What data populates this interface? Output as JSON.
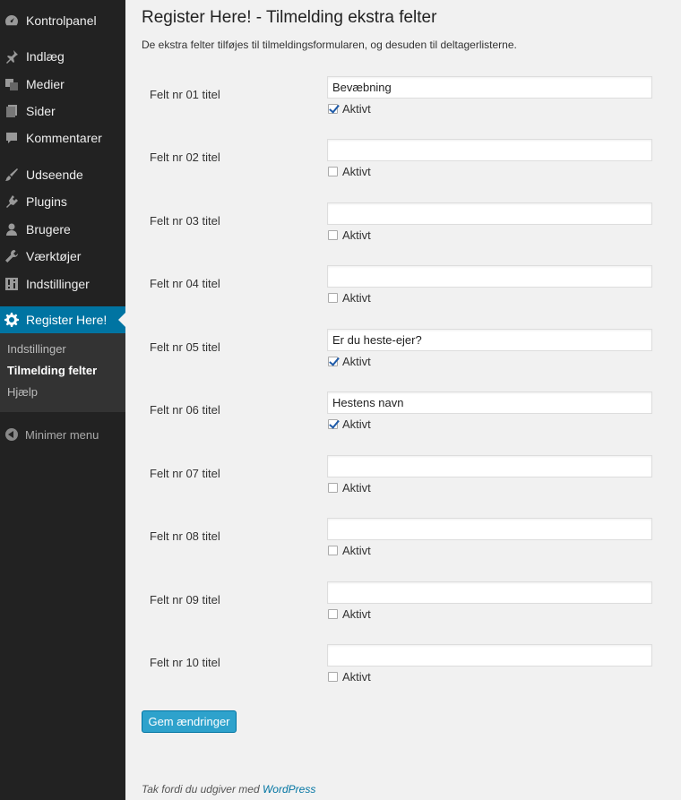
{
  "sidebar": {
    "items": [
      {
        "label": "Kontrolpanel",
        "icon": "dashboard-icon"
      },
      {
        "label": "Indlæg",
        "icon": "pushpin-icon"
      },
      {
        "label": "Medier",
        "icon": "media-icon"
      },
      {
        "label": "Sider",
        "icon": "pages-icon"
      },
      {
        "label": "Kommentarer",
        "icon": "comments-icon"
      },
      {
        "label": "Udseende",
        "icon": "brush-icon"
      },
      {
        "label": "Plugins",
        "icon": "plugin-icon"
      },
      {
        "label": "Brugere",
        "icon": "users-icon"
      },
      {
        "label": "Værktøjer",
        "icon": "wrench-icon"
      },
      {
        "label": "Indstillinger",
        "icon": "settings-icon"
      }
    ],
    "current": {
      "label": "Register Here!",
      "icon": "gear-icon"
    },
    "submenu": [
      "Indstillinger",
      "Tilmelding felter",
      "Hjælp"
    ],
    "collapse_label": "Minimer menu"
  },
  "page": {
    "title": "Register Here! - Tilmelding ekstra felter",
    "description": "De ekstra felter tilføjes til tilmeldingsformularen, og desuden til deltagerlisterne.",
    "active_label": "Aktivt",
    "fields": [
      {
        "label": "Felt nr 01 titel",
        "value": "Bevæbning",
        "active": true
      },
      {
        "label": "Felt nr 02 titel",
        "value": "",
        "active": false
      },
      {
        "label": "Felt nr 03 titel",
        "value": "",
        "active": false
      },
      {
        "label": "Felt nr 04 titel",
        "value": "",
        "active": false
      },
      {
        "label": "Felt nr 05 titel",
        "value": "Er du heste-ejer?",
        "active": true
      },
      {
        "label": "Felt nr 06 titel",
        "value": "Hestens navn",
        "active": true
      },
      {
        "label": "Felt nr 07 titel",
        "value": "",
        "active": false
      },
      {
        "label": "Felt nr 08 titel",
        "value": "",
        "active": false
      },
      {
        "label": "Felt nr 09 titel",
        "value": "",
        "active": false
      },
      {
        "label": "Felt nr 10 titel",
        "value": "",
        "active": false
      }
    ],
    "save_label": "Gem ændringer",
    "footer_text": "Tak fordi du udgiver med ",
    "footer_link": "WordPress"
  },
  "colors": {
    "accent": "#0074a2",
    "button": "#2ea2cc",
    "sidebar": "#222222"
  }
}
